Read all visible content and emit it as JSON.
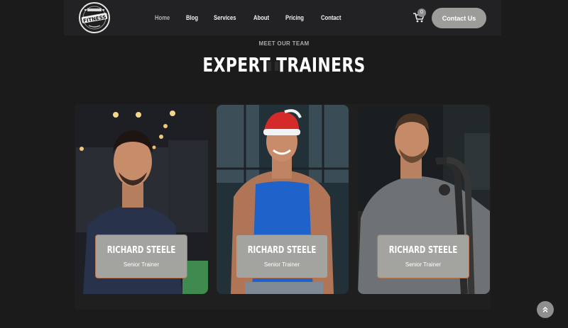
{
  "nav": {
    "logo_text": "FITNESS",
    "links": [
      "Home",
      "Blog",
      "Services",
      "About",
      "Pricing",
      "Contact"
    ],
    "active_index": 0,
    "cart_count": "0",
    "contact_label": "Contact Us"
  },
  "team": {
    "eyebrow": "MEET OUR TEAM",
    "heading": "EXPERT TRAINERS",
    "members": [
      {
        "name": "RICHARD STEELE",
        "role": "Senior Trainer"
      },
      {
        "name": "RICHARD STEELE",
        "role": "Senior Trainer"
      },
      {
        "name": "RICHARD STEELE",
        "role": "Senior Trainer"
      }
    ]
  },
  "colors": {
    "page_bg": "#1b1b1b",
    "navbar_bg": "#222225",
    "button_bg": "#9c9c98",
    "info_box_bg": "#a3a39f",
    "info_box_border": "#b57551"
  }
}
